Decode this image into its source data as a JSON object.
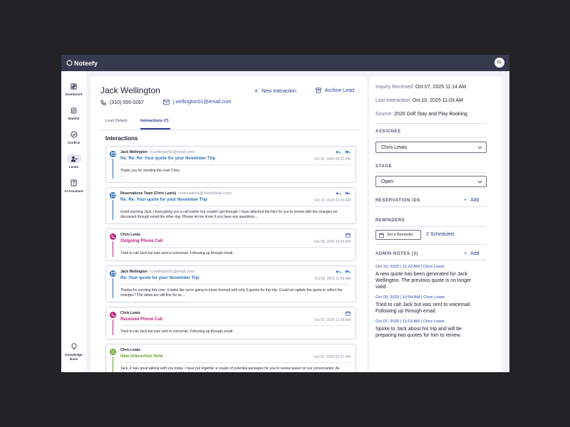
{
  "app": {
    "name": "Noteefy",
    "user_initials": "CL"
  },
  "nav": [
    {
      "label": "Dashboard",
      "icon": "dashboard-icon"
    },
    {
      "label": "Waitlist",
      "icon": "waitlist-icon"
    },
    {
      "label": "Confirm",
      "icon": "confirm-icon"
    },
    {
      "label": "Leads",
      "icon": "leads-icon",
      "active": true
    },
    {
      "label": "AI Assistant",
      "icon": "ai-assistant-icon"
    },
    {
      "label": "Knowledge Base",
      "icon": "lightbulb-icon"
    }
  ],
  "lead": {
    "name": "Jack Wellington",
    "phone": "(310) 555-3267",
    "email": "j.wellington01@email.com",
    "new_interaction": "New Interaction",
    "archive_lead": "Archive Lead"
  },
  "tabs": [
    "Lead Details",
    "Interactions (7)"
  ],
  "interactions_title": "Interactions",
  "interactions": [
    {
      "sender": "Jack Wellington",
      "sender_email": "<j.wellington01@email.com>",
      "subject": "Re: Re: Re: Your quote for your November Trip",
      "timestamp": "Oct 10, 2025 05:22 PM",
      "body": "Thank you for sending this over Chris.\n..."
    },
    {
      "sender": "Reservations Team (Chris Lewis)",
      "sender_email": "<reservations@noteefylinks.com>",
      "subject": "Re: Re: Your quote for your November Trip",
      "timestamp": "Oct 10, 2025 11:03 AM",
      "body": "Good morning Jack, I tried giving you a call earlier but couldn't get through. I have attached the files for you to review with the changes we discussed through email the other day. Please let me know if you have any questions...."
    },
    {
      "sender": "Chris Lewis",
      "sender_email": "",
      "subject": "Outgoing Phone Call",
      "timestamp": "Oct 09, 2025 10:54 AM",
      "body": "Tried to call Jack but was sent to voicemail. Following up through email."
    },
    {
      "sender": "Jack Wellington",
      "sender_email": "<j.wellington01@email.com>",
      "subject": "Re: Your quote for your November Trip",
      "timestamp": "Oct 08, 2025 11:03 AM",
      "body": "Thanks for sending this over. It looks like we're going to move forward with only 6 guests for this trip. Could we update the quote to reflect the changes? The dates are still fine for us...."
    },
    {
      "sender": "Chris Lewis",
      "sender_email": "",
      "subject": "Received Phone Call",
      "timestamp": "Oct 07, 2025 11:14 AM",
      "body": "Tried to call Jack but was sent to voicemail. Following up through email."
    },
    {
      "sender": "Chris Lewis",
      "sender_email": "",
      "subject": "New Interaction Note",
      "timestamp": "Oct 07, 2025 01:57 PM",
      "body": "Jack, it was great talking with you today. I have put together a couple of potential packages for you to review based on our conversation. As always, if you have any questions don't hesitate to reach out again."
    }
  ],
  "details": {
    "inquiry_label": "Inquiry Received:",
    "inquiry_value": "Oct 07, 2025 11:14 AM",
    "last_label": "Last Interaction:",
    "last_value": "Oct 10, 2025 11:03 AM",
    "source_label": "Source:",
    "source_value": "2026 Golf Stay and Play Booking"
  },
  "assignee": {
    "title": "ASSIGNEE",
    "value": "Chris Lewis"
  },
  "stage": {
    "title": "STAGE",
    "value": "Open"
  },
  "reservation_ids": {
    "title": "RESERVATION IDS",
    "add": "Add"
  },
  "reminders": {
    "title": "REMINDERS",
    "button": "Set a Reminder",
    "scheduled": "2 Scheduled"
  },
  "admin_notes": {
    "title": "ADMIN NOTES (3)",
    "add": "Add",
    "notes": [
      {
        "meta": "Oct 10, 2025 | 11:22 AM | Chris Lewis",
        "text": "A new quote has been generated for Jack Wellington. The previous quote is no longer valid."
      },
      {
        "meta": "Oct 09, 2025 | 10:54 AM | Chris Lewis",
        "text": "Tried to call Jack but was sent to voicemail. Following up through email."
      },
      {
        "meta": "Oct 07, 2025 | 11:03 AM | Chris Lewis",
        "text": "Spoke to Jack about his trip and will be preparing two quotes for him to review."
      }
    ]
  },
  "colors": {
    "topbar": "#363a4d",
    "accent": "#2a3a8f",
    "email_subject": "#2b6cb8",
    "call_subject": "#c2237e",
    "note_subject": "#6aa32a"
  }
}
